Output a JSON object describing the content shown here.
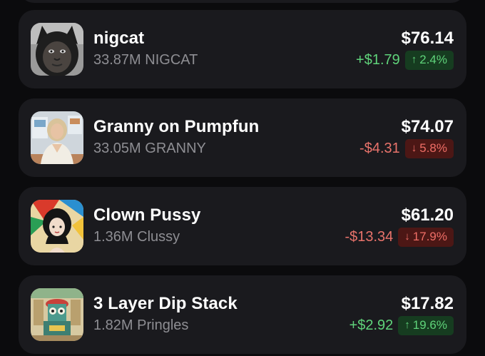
{
  "holdings": [
    {
      "name": "nigcat",
      "amount": "33.87M",
      "ticker": "NIGCAT",
      "price": "$76.14",
      "change": "+$1.79",
      "percent": "2.4%",
      "direction": "up",
      "arrow": "↑",
      "avatar_icon": "black-cat-avatar-icon"
    },
    {
      "name": "Granny on Pumpfun",
      "amount": "33.05M",
      "ticker": "GRANNY",
      "price": "$74.07",
      "change": "-$4.31",
      "percent": "5.8%",
      "direction": "down",
      "arrow": "↓",
      "avatar_icon": "granny-avatar-icon"
    },
    {
      "name": "Clown Pussy",
      "amount": "1.36M",
      "ticker": "Clussy",
      "price": "$61.20",
      "change": "-$13.34",
      "percent": "17.9%",
      "direction": "down",
      "arrow": "↓",
      "avatar_icon": "clown-girl-avatar-icon"
    },
    {
      "name": "3 Layer Dip Stack",
      "amount": "1.82M",
      "ticker": "Pringles",
      "price": "$17.82",
      "change": "+$2.92",
      "percent": "19.6%",
      "direction": "up",
      "arrow": "↑",
      "avatar_icon": "pringles-cartoon-avatar-icon"
    }
  ],
  "colors": {
    "background": "#0b0b0d",
    "card": "#1a1a1e",
    "up_text": "#5fd37a",
    "up_pill": "#163c20",
    "down_text": "#e8736b",
    "down_pill": "#4c1715",
    "secondary_text": "#8e8e93"
  }
}
